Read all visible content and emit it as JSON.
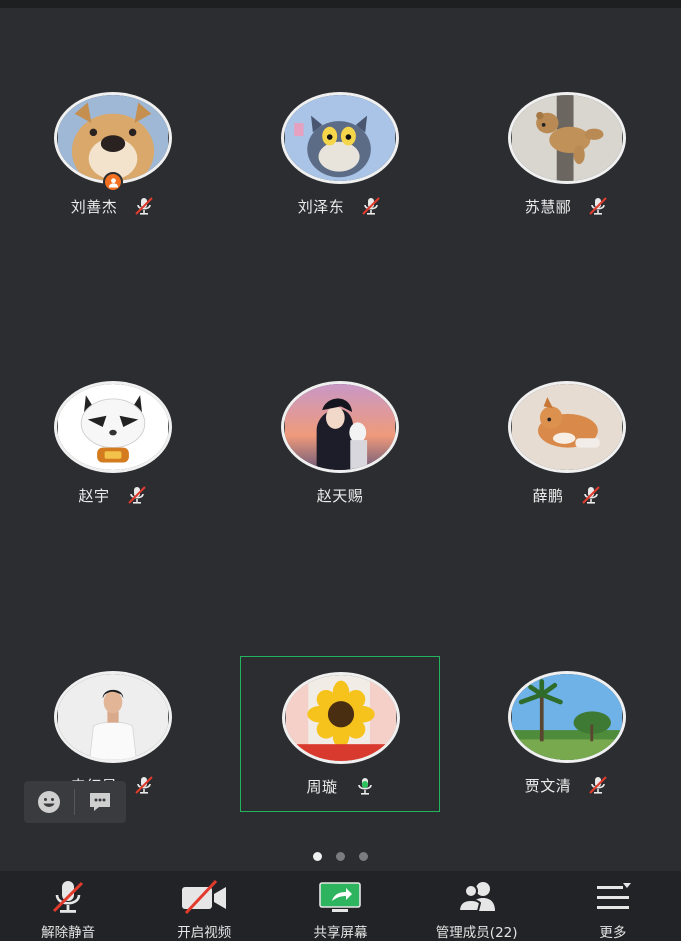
{
  "participants": [
    {
      "name": "刘善杰",
      "mic": "muted",
      "host": true,
      "avatar": "shiba-dog-avatar"
    },
    {
      "name": "刘泽东",
      "mic": "muted",
      "host": false,
      "avatar": "cartoon-cat-avatar"
    },
    {
      "name": "苏慧郦",
      "mic": "muted",
      "host": false,
      "avatar": "teddy-bear-avatar"
    },
    {
      "name": "赵宇",
      "mic": "muted",
      "host": false,
      "avatar": "cartoon-panda-avatar"
    },
    {
      "name": "赵天赐",
      "mic": "none",
      "host": false,
      "avatar": "anime-sunset-avatar"
    },
    {
      "name": "薛鹏",
      "mic": "muted",
      "host": false,
      "avatar": "puppy-avatar"
    },
    {
      "name": "申红星",
      "mic": "muted",
      "host": false,
      "avatar": "man-white-shirt-avatar"
    },
    {
      "name": "周璇",
      "mic": "speaking",
      "host": false,
      "avatar": "sunflower-avatar"
    },
    {
      "name": "贾文清",
      "mic": "muted",
      "host": false,
      "avatar": "palm-trees-avatar"
    }
  ],
  "pagination": {
    "pages": 3,
    "current": 1
  },
  "toolbar": {
    "unmute_label": "解除静音",
    "video_label": "开启视频",
    "share_label": "共享屏幕",
    "members_label": "管理成员(22)",
    "more_label": "更多"
  },
  "icons": {
    "reaction": "emoji-icon",
    "chat": "chat-bubble-icon"
  },
  "colors": {
    "background": "#2c2d30",
    "toolbar": "#222326",
    "speaking": "#22b35e",
    "muted": "#e23b2e",
    "host": "#f2701f"
  }
}
